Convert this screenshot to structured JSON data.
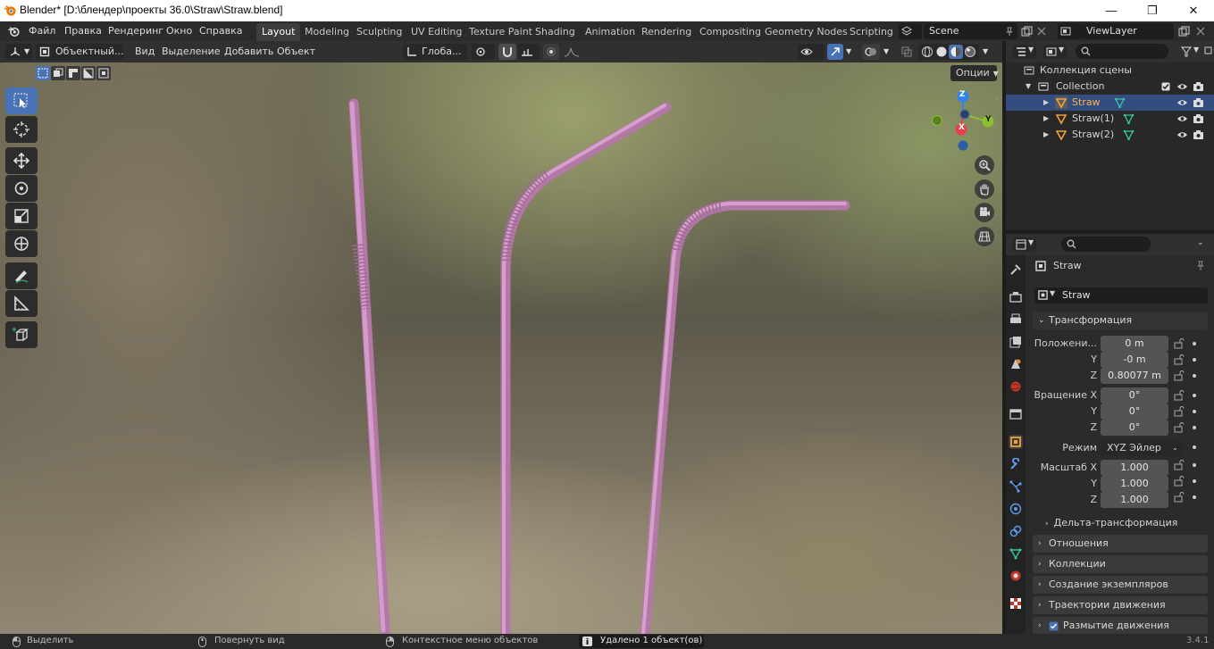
{
  "titlebar": {
    "title": "Blender* [D:\\блендер\\проекты 36.0\\Straw\\Straw.blend]"
  },
  "menu": {
    "file": "Файл",
    "edit": "Правка",
    "render": "Рендеринг",
    "window": "Окно",
    "help": "Справка"
  },
  "workspaces": [
    "Layout",
    "Modeling",
    "Sculpting",
    "UV Editing",
    "Texture Paint",
    "Shading",
    "Animation",
    "Rendering",
    "Compositing",
    "Geometry Nodes",
    "Scripting"
  ],
  "scene": {
    "name": "Scene"
  },
  "viewlayer": {
    "name": "ViewLayer"
  },
  "viewport_header": {
    "mode": "Объектный...",
    "view": "Вид",
    "select": "Выделение",
    "add": "Добавить",
    "object": "Объект",
    "orientation": "Глоба...",
    "options": "Опции"
  },
  "gizmo": {
    "z": "Z",
    "y": "Y",
    "x": "X"
  },
  "outliner": {
    "scene_collection": "Коллекция сцены",
    "collection": "Collection",
    "items": [
      {
        "name": "Straw"
      },
      {
        "name": "Straw(1)"
      },
      {
        "name": "Straw(2)"
      }
    ]
  },
  "properties": {
    "object_title": "Straw",
    "object_name": "Straw",
    "transform_label": "Трансформация",
    "location_label": "Положени...",
    "loc_x": "0 m",
    "loc_y": "-0 m",
    "loc_z": "0.80077 m",
    "rotation_label": "Вращение X",
    "rot_x": "0°",
    "rot_y": "0°",
    "rot_z": "0°",
    "mode_label": "Режим",
    "mode_value": "XYZ Эйлер",
    "scale_label": "Масштаб X",
    "scale_x": "1.000",
    "scale_y": "1.000",
    "scale_z": "1.000",
    "axis_y": "Y",
    "axis_z": "Z",
    "delta": "Дельта-трансформация",
    "relations": "Отношения",
    "collections": "Коллекции",
    "instancing": "Создание экземпляров",
    "motion_paths": "Траектории движения",
    "motion_blur": "Размытие движения"
  },
  "statusbar": {
    "select": "Выделить",
    "rotate": "Повернуть вид",
    "context": "Контекстное меню объектов",
    "message": "Удалено 1 объект(ов)",
    "version": "3.4.1"
  },
  "colors": {
    "accent": "#4772b3",
    "straw": "#c98ac0",
    "selected_row": "#334d80",
    "x_axis": "#e8414d",
    "y_axis": "#8bc12f",
    "z_axis": "#2d85f2"
  }
}
